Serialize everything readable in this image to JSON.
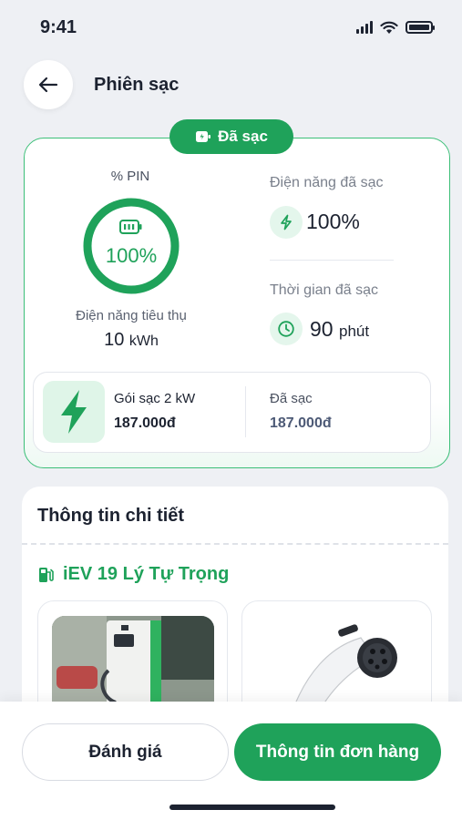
{
  "status_bar": {
    "time": "9:41"
  },
  "header": {
    "title": "Phiên sạc"
  },
  "session": {
    "status_label": "Đã sạc",
    "pin_label": "% PIN",
    "pin_percent": "100%",
    "pin_fraction": 1.0,
    "consumption_label": "Điện năng tiêu thụ",
    "consumption_value": "10",
    "consumption_unit": "kWh",
    "energy_charged_label": "Điện năng đã sạc",
    "energy_charged_value": "100%",
    "charge_time_label": "Thời gian đã sạc",
    "charge_time_value": "90",
    "charge_time_unit": "phút",
    "package_name": "Gói sạc 2 kW",
    "package_price": "187.000đ",
    "charged_label": "Đã sạc",
    "charged_amount": "187.000đ"
  },
  "details": {
    "title": "Thông tin chi tiết",
    "station_name": "iEV 19 Lý Tự Trọng"
  },
  "actions": {
    "rate_label": "Đánh giá",
    "order_info_label": "Thông tin đơn hàng"
  },
  "colors": {
    "accent": "#1fa25a",
    "text_dark": "#1c2230",
    "background": "#eef0f4"
  }
}
